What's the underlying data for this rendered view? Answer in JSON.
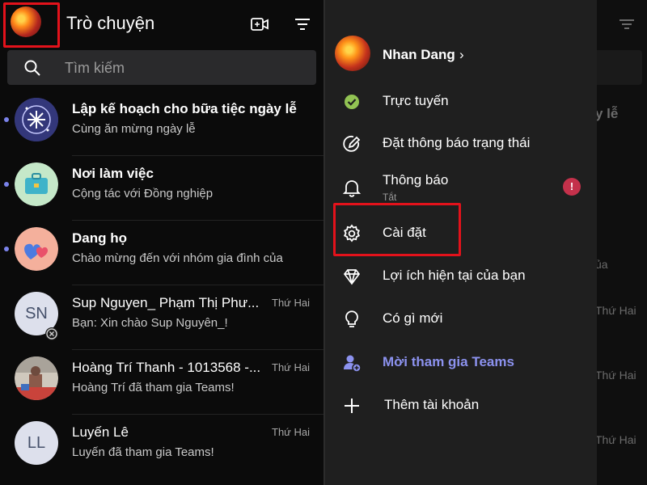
{
  "header": {
    "title": "Trò chuyện",
    "search_placeholder": "Tìm kiếm"
  },
  "chats": [
    {
      "name": "Lập kế hoạch cho bữa tiệc ngày lễ",
      "preview": "Cùng ăn mừng ngày lễ",
      "time": "",
      "unread": true,
      "avatar_icon": "snowflake-icon",
      "avatar_color": "#3b3f86"
    },
    {
      "name": "Nơi làm việc",
      "preview": "Cộng tác với Đồng nghiệp",
      "time": "",
      "unread": true,
      "avatar_icon": "briefcase-icon",
      "avatar_color": "#bfe3c3"
    },
    {
      "name": "Dang họ",
      "preview": "Chào mừng đến với nhóm gia đình của",
      "time": "",
      "unread": true,
      "avatar_icon": "hearts-icon",
      "avatar_color": "#f6b8a4"
    },
    {
      "name": "Sup Nguyen_ Phạm Thị Phư...",
      "preview": "Bạn: Xin chào Sup Nguyên_!",
      "time": "Thứ Hai",
      "unread": false,
      "initials": "SN",
      "avatar_color": "#dde0ec"
    },
    {
      "name": "Hoàng Trí Thanh - 1013568 -...",
      "preview": "Hoàng Trí đã tham gia Teams!",
      "time": "Thứ Hai",
      "unread": false,
      "avatar_icon": "photo-avatar",
      "avatar_color": "#c8c2b8"
    },
    {
      "name": "Luyến Lê",
      "preview": "Luyến đã tham gia Teams!",
      "time": "Thứ Hai",
      "unread": false,
      "initials": "LL",
      "avatar_color": "#dde0ec"
    }
  ],
  "drawer": {
    "profile_name": "Nhan Dang",
    "profile_chevron": "›",
    "items": [
      {
        "label": "Trực tuyến",
        "icon": "status-available-icon"
      },
      {
        "label": "Đặt thông báo trạng thái",
        "icon": "edit-status-icon"
      },
      {
        "label": "Thông báo",
        "sublabel": "Tắt",
        "icon": "bell-icon",
        "badge": "!"
      },
      {
        "label": "Cài đặt",
        "icon": "gear-icon"
      },
      {
        "label": "Lợi ích hiện tại của bạn",
        "icon": "diamond-icon"
      },
      {
        "label": "Có gì mới",
        "icon": "lightbulb-icon"
      },
      {
        "label": "Mời tham gia Teams",
        "icon": "add-people-icon"
      },
      {
        "label": "Thêm tài khoản",
        "icon": "plus-icon"
      }
    ]
  },
  "peek": {
    "fragment_1": "y lễ",
    "fragment_2": "ủa",
    "times": [
      "Thứ Hai",
      "Thứ Hai",
      "Thứ Hai"
    ]
  },
  "colors": {
    "accent": "#7b83eb",
    "highlight": "#e3121b",
    "online": "#92c353",
    "badge": "#c4314b"
  }
}
